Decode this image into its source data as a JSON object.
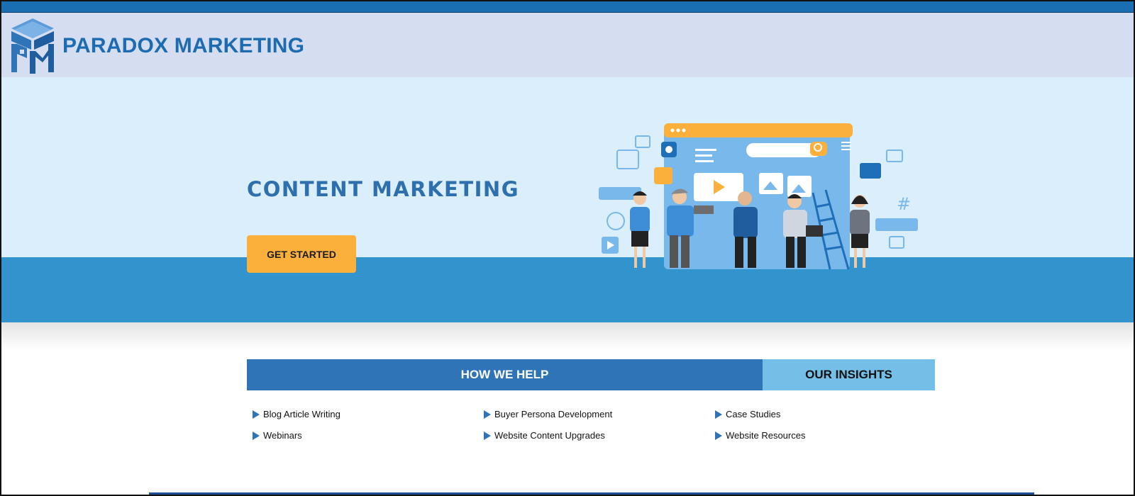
{
  "header": {
    "brand": "PARADOX MARKETING",
    "logo_icon": "pm-cube-logo"
  },
  "hero": {
    "title": "CONTENT MARKETING",
    "cta_label": "GET STARTED",
    "illustration": "content-marketing-team-illustration"
  },
  "tabs": [
    {
      "label": "HOW WE HELP",
      "active": true
    },
    {
      "label": "OUR INSIGHTS",
      "active": false
    }
  ],
  "links": {
    "col1": [
      "Blog Article Writing",
      "Webinars"
    ],
    "col2": [
      "Buyer Persona Development",
      "Website Content Upgrades"
    ],
    "col3": [
      "Case Studies",
      "Website Resources"
    ]
  },
  "colors": {
    "topbar": "#1a6fb3",
    "header_bg": "#d5ddf1",
    "hero_bg": "#dbeefb",
    "hero_band": "#3394cd",
    "brand_blue": "#1d6bb0",
    "cta_orange": "#fbb03b",
    "tab_active": "#2f74b6",
    "tab_inactive": "#73bfe7"
  }
}
